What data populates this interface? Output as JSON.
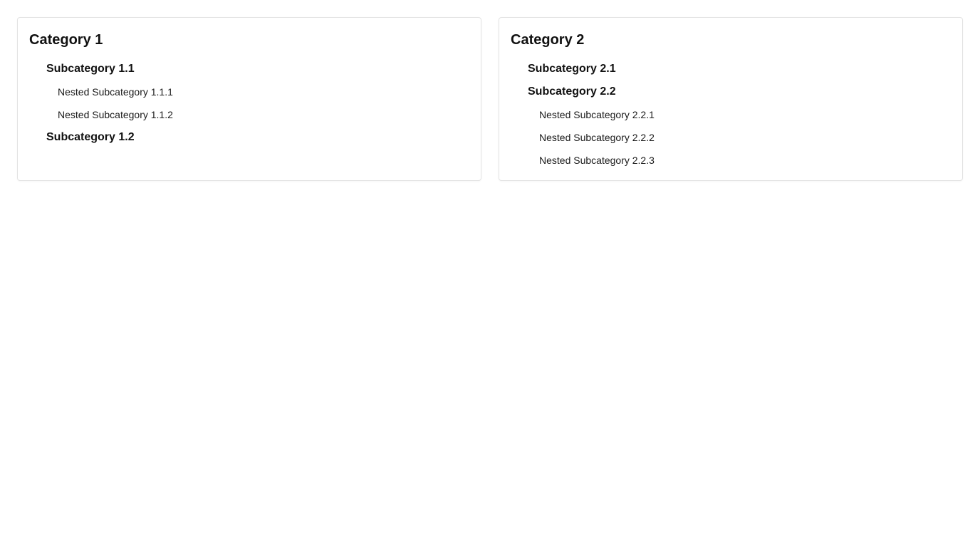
{
  "categories": [
    {
      "title": "Category 1",
      "subcategories": [
        {
          "label": "Subcategory 1.1",
          "nested": [
            "Nested Subcategory 1.1.1",
            "Nested Subcategory 1.1.2"
          ]
        },
        {
          "label": "Subcategory 1.2",
          "nested": []
        }
      ]
    },
    {
      "title": "Category 2",
      "subcategories": [
        {
          "label": "Subcategory 2.1",
          "nested": []
        },
        {
          "label": "Subcategory 2.2",
          "nested": [
            "Nested Subcategory 2.2.1",
            "Nested Subcategory 2.2.2",
            "Nested Subcategory 2.2.3"
          ]
        }
      ]
    }
  ],
  "colors": {
    "background": "#ffffff",
    "card_border": "#e3e3e3",
    "text": "#111111"
  }
}
